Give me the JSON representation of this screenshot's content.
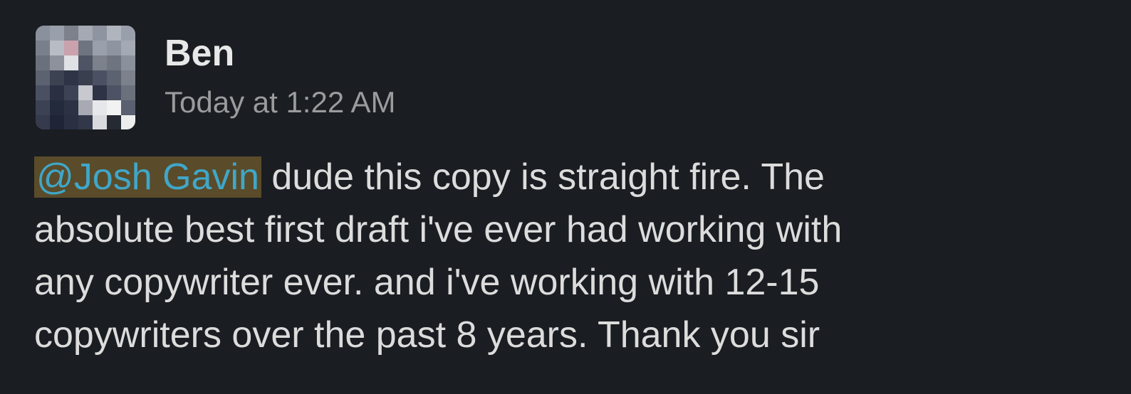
{
  "message": {
    "author": "Ben",
    "timestamp": "Today at 1:22 AM",
    "mention": "@Josh Gavin",
    "lines": [
      " dude this copy is straight fire. The",
      "absolute best first draft i've ever had working with",
      "any copywriter ever. and i've working with 12-15",
      "copywriters over the past 8 years. Thank you sir"
    ]
  },
  "colors": {
    "background": "#1a1d21",
    "mention_background": "#5a4b2a",
    "mention_text": "#3fa7c9",
    "timestamp": "#9a9b9d"
  }
}
